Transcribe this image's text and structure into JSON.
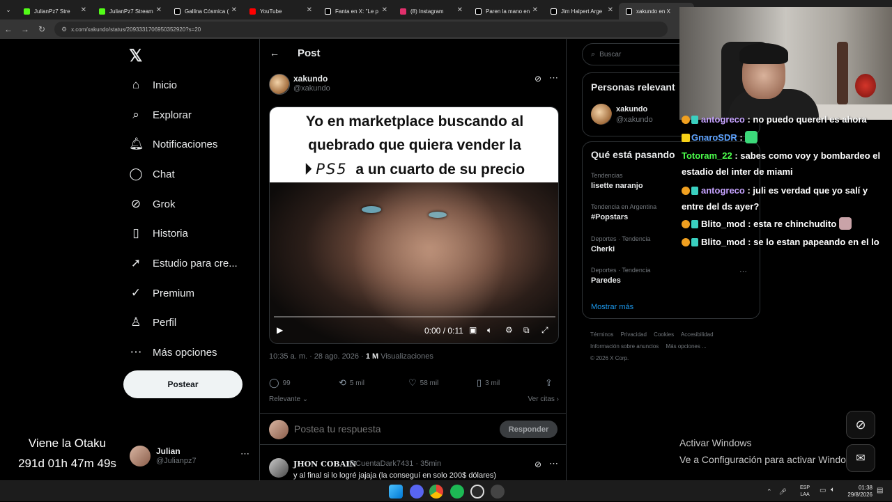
{
  "browser": {
    "tabs": [
      {
        "title": "JulianPz7 Stre",
        "color": "#53fc18"
      },
      {
        "title": "JulianPz7 Stream",
        "color": "#53fc18"
      },
      {
        "title": "Gallina Cósmica (",
        "color": "#ffffff"
      },
      {
        "title": "YouTube",
        "color": "#ff0000"
      },
      {
        "title": "Fanta en X: \"Le p",
        "color": "#ffffff"
      },
      {
        "title": "(8) Instagram",
        "color": "#e1306c"
      },
      {
        "title": "Paren la mano en",
        "color": "#ffffff"
      },
      {
        "title": "Jim Halpert Arge",
        "color": "#ffffff"
      },
      {
        "title": "xakundo en X",
        "color": "#ffffff"
      }
    ],
    "url": "x.com/xakundo/status/2093331706950352920?s=20"
  },
  "nav": {
    "items": [
      {
        "label": "Inicio",
        "icon": "⌂"
      },
      {
        "label": "Explorar",
        "icon": "⌕"
      },
      {
        "label": "Notificaciones",
        "icon": "🔔︎"
      },
      {
        "label": "Chat",
        "icon": "◯"
      },
      {
        "label": "Grok",
        "icon": "⊘"
      },
      {
        "label": "Historia",
        "icon": "▯"
      },
      {
        "label": "Estudio para cre...",
        "icon": "➚"
      },
      {
        "label": "Premium",
        "icon": "✓"
      },
      {
        "label": "Perfil",
        "icon": "♙"
      },
      {
        "label": "Más opciones",
        "icon": "⋯"
      }
    ],
    "post_button": "Postear",
    "account": {
      "name": "Julian",
      "handle": "@Julianpz7"
    }
  },
  "overlay_timer": {
    "line1": "Viene la Otaku",
    "line2": "291d 01h 47m 49s"
  },
  "post": {
    "header_title": "Post",
    "author_name": "xakundo",
    "author_handle": "@xakundo",
    "meme_line1": "Yo en marketplace buscando al",
    "meme_line2": "quebrado que quiera vender la",
    "meme_ps5": "PS5",
    "meme_line3": "a un cuarto de su precio",
    "video_time": "0:00 / 0:11",
    "video_progress": 0,
    "timestamp": "10:35 a. m. · 28 ago. 2026 · ",
    "views_count": "1 M",
    "views_label": " Visualizaciones",
    "replies": "99",
    "reposts": "5 mil",
    "likes": "58 mil",
    "bookmarks": "3 mil",
    "sort_label": "Relevante",
    "quotes_label": "Ver citas"
  },
  "reply_composer": {
    "placeholder": "Postea tu respuesta",
    "button": "Responder"
  },
  "first_reply": {
    "name": "JHON COBAIN",
    "meta": "@CuentaDark7431 · 35min",
    "text": "y al final si lo logré jajaja (la conseguí en solo 200$ dólares)"
  },
  "sidebar": {
    "search_placeholder": "Buscar",
    "relevant_title": "Personas relevant",
    "relevant_name": "xakundo",
    "relevant_handle": "@xakundo",
    "trends_title": "Qué está pasando",
    "trends": [
      {
        "context": "Tendencias",
        "name": "lisette naranjo"
      },
      {
        "context": "Tendencia en Argentina",
        "name": "#Popstars"
      },
      {
        "context": "Deportes · Tendencia",
        "name": "Cherki"
      },
      {
        "context": "Deportes · Tendencia",
        "name": "Paredes"
      }
    ],
    "show_more": "Mostrar más",
    "footer": [
      "Términos",
      "Privacidad",
      "Cookies",
      "Accesibilidad",
      "Información sobre anuncios",
      "Más opciones ...",
      "© 2026 X Corp."
    ]
  },
  "chat": [
    {
      "user": "antogreco",
      "user_color": "#c6a3ff",
      "text": " : no puedo quererl es ahora"
    },
    {
      "user": "GnaroSDR",
      "user_color": "#5ea3ff",
      "text": " : "
    },
    {
      "user": "Totoram_22",
      "user_color": "#4cff4c",
      "text": " : sabes como voy y bombardeo el estadio del inter de miami"
    },
    {
      "user": "antogreco",
      "user_color": "#c6a3ff",
      "text": " : juli es verdad que yo salí y entre del ds ayer?"
    },
    {
      "user": "Blito_mod",
      "user_color": "#ffffff",
      "text": " : esta re chinchudito"
    },
    {
      "user": "Blito_mod",
      "user_color": "#ffffff",
      "text": " : se lo estan papeando en el lo"
    }
  ],
  "activate_windows": {
    "line1": "Activar Windows",
    "line2": "Ve a Configuración para activar Windows"
  },
  "taskbar": {
    "lang1": "ESP",
    "lang2": "LAA",
    "time": "01:38",
    "date": "29/8/2026"
  }
}
